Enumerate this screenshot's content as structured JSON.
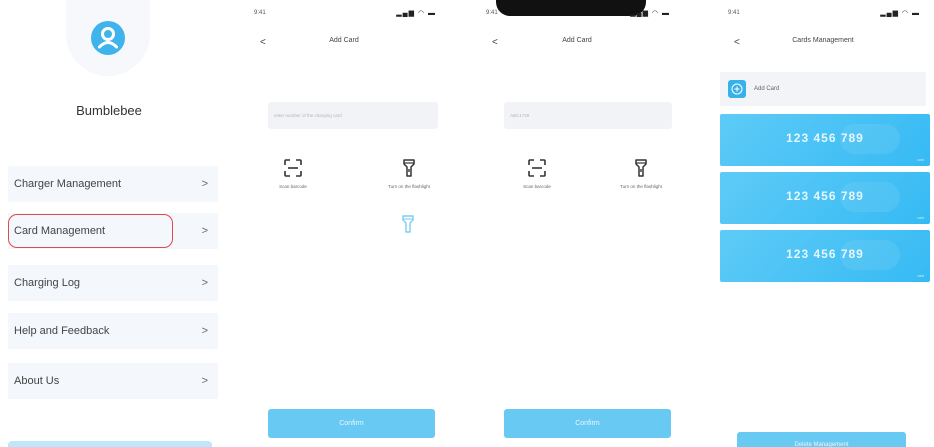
{
  "profile": {
    "username": "Bumblebee",
    "avatar_icon": "user-avatar-icon",
    "accent_color": "#3fb4ec",
    "menu": [
      {
        "label": "Charger Management",
        "chevron": ">"
      },
      {
        "label": "Card Management",
        "chevron": ">",
        "highlighted": true
      },
      {
        "label": "Charging Log",
        "chevron": ">"
      },
      {
        "label": "Help and Feedback",
        "chevron": ">"
      },
      {
        "label": "About Us",
        "chevron": ">"
      }
    ]
  },
  "add_card_empty": {
    "status_time": "9:41",
    "back": "<",
    "title": "Add Card",
    "input_placeholder": "enter number of the charging card",
    "scan_label": "Scan barcode",
    "flashlight_label": "Turn on the flashlight",
    "confirm_label": "Confirm"
  },
  "add_card_filled": {
    "status_time": "9:41",
    "back": "<",
    "title": "Add Card",
    "input_value": "ABC1729",
    "scan_label": "Scan barcode",
    "flashlight_label": "Turn on the flashlight",
    "confirm_label": "Confirm"
  },
  "cards_management": {
    "status_time": "9:41",
    "back": "<",
    "title": "Cards Management",
    "add_card_label": "Add Card",
    "cards": [
      {
        "number": "123 456 789",
        "tag": "card"
      },
      {
        "number": "123 456 789",
        "tag": "card"
      },
      {
        "number": "123 456 789",
        "tag": "card"
      }
    ],
    "delete_label": "Delete Management"
  },
  "colors": {
    "primary": "#68c9f2",
    "card": "#44c0f5",
    "highlight_border": "#e04a4a",
    "menu_bg": "#f4f7fb"
  }
}
